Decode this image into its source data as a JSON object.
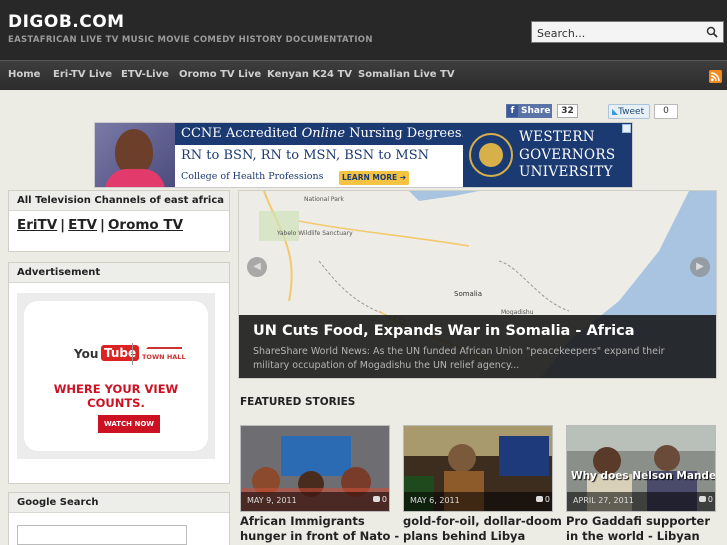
{
  "site": {
    "title": "DIGOB.COM",
    "tagline": "EASTAFRICAN LIVE TV MUSIC MOVIE COMEDY HISTORY DOCUMENTATION",
    "search_placeholder": "Search..."
  },
  "nav": {
    "items": [
      "Home",
      "Eri-TV Live",
      "ETV-Live",
      "Oromo TV Live",
      "Kenyan K24 TV",
      "Somalian Live TV"
    ]
  },
  "social": {
    "share_label": "Share",
    "share_count": "32",
    "tweet_label": "Tweet",
    "tweet_count": "0"
  },
  "ad_banner": {
    "headline_pre": "CCNE Accredited ",
    "headline_italic": "Online",
    "headline_post": " Nursing Degrees.",
    "line1": "RN to BSN, RN to MSN, BSN to MSN",
    "line2": "College of Health Professions",
    "cta": "LEARN MORE ➔",
    "university_line1": "WESTERN",
    "university_line2": "GOVERNORS",
    "university_line3": "UNIVERSITY"
  },
  "sidebar": {
    "tv_widget_title": "All Television Channels of east africa",
    "tv_links": [
      "EriTV",
      "ETV",
      "Oromo TV"
    ],
    "tv_sep": "|",
    "ad_widget_title": "Advertisement",
    "yt_ad": {
      "you": "You",
      "tube": "Tube",
      "townhall": "TOWN HALL",
      "slogan": "WHERE YOUR VIEW COUNTS.",
      "button": "WATCH NOW"
    },
    "google_widget_title": "Google Search"
  },
  "slider": {
    "title": "UN Cuts Food, Expands War in Somalia - Africa",
    "excerpt": "ShareShare World News: As the UN funded African Union \"peacekeepers\" expand their military occupation of Mogadishu the UN relief agency...",
    "map_labels": [
      "National Park",
      "Yabelo Wildlife Sanctuary",
      "Somalia",
      "Mogadishu"
    ]
  },
  "featured": {
    "heading": "FEATURED STORIES",
    "posts": [
      {
        "date": "MAY 9, 2011",
        "comments": "0",
        "title": "African Immigrants hunger in front of Nato -"
      },
      {
        "date": "MAY 6, 2011",
        "comments": "0",
        "title": "gold-for-oil, dollar-doom plans behind Libya"
      },
      {
        "date": "APRIL 27, 2011",
        "comments": "0",
        "title": "Pro Gaddafi supporter in the world - Libyan war",
        "overlay": "Why does Nelson Mandela"
      }
    ]
  },
  "colors": {
    "header_bg": "#282828",
    "page_bg": "#ecebe4",
    "nav_text": "#cfcfcf",
    "ad_blue": "#1b3a72",
    "youtube_red": "#cc1122"
  }
}
